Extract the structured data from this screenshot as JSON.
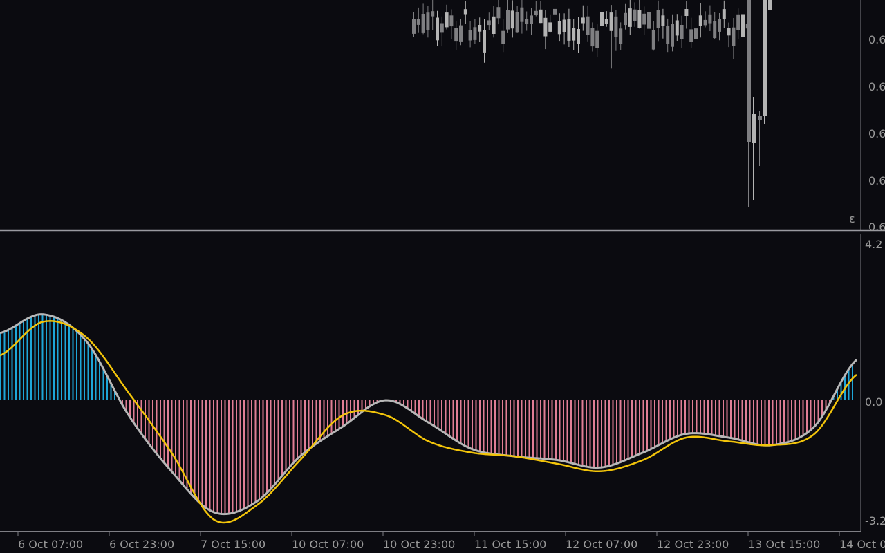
{
  "colors": {
    "background": "#0b0b10",
    "panel_border": "#7e7e84",
    "candle_bull": "#b4b4b4",
    "candle_bear": "#7f7f82",
    "hist_positive": "#1ea6d8",
    "hist_negative": "#e07e95",
    "macd_line": "#b7b7b7",
    "signal_line": "#f2c40a",
    "axis_text": "#9a9a9a"
  },
  "price_panel": {
    "price_labels": [
      "0.6",
      "0.6",
      "0.6",
      "0.6",
      "0.6"
    ],
    "bottom_price_label": "0.6",
    "corner_mark": "ε"
  },
  "time_axis": {
    "labels": [
      "6 Oct 07:00",
      "6 Oct 23:00",
      "7 Oct 15:00",
      "10 Oct 07:00",
      "10 Oct 23:00",
      "11 Oct 15:00",
      "12 Oct 07:00",
      "12 Oct 23:00",
      "13 Oct 15:00",
      "14 Oct 0"
    ]
  },
  "chart_data": {
    "type": "line",
    "indicator_axis": {
      "ylim": [
        -3.2,
        4.2
      ],
      "tick_labels": [
        "4.2",
        "0.0",
        "-3.2"
      ]
    },
    "x": [
      0,
      12,
      24,
      36,
      48,
      60,
      72,
      84,
      96,
      108,
      120,
      132,
      144,
      156,
      168,
      180,
      192,
      204,
      216,
      228,
      240
    ],
    "series": [
      {
        "kind": "histogram_and_line",
        "values": [
          1.8,
          2.3,
          1.6,
          -0.4,
          -1.9,
          -3.0,
          -2.7,
          -1.5,
          -0.7,
          0.0,
          -0.6,
          -1.3,
          -1.5,
          -1.6,
          -1.8,
          -1.4,
          -0.9,
          -1.0,
          -1.2,
          -0.7,
          1.1
        ]
      },
      {
        "kind": "signal_line",
        "values": [
          1.2,
          2.1,
          1.7,
          0.2,
          -1.4,
          -3.2,
          -2.8,
          -1.6,
          -0.4,
          -0.4,
          -1.1,
          -1.4,
          -1.5,
          -1.7,
          -1.9,
          -1.6,
          -1.0,
          -1.1,
          -1.2,
          -0.9,
          0.7
        ]
      }
    ]
  }
}
